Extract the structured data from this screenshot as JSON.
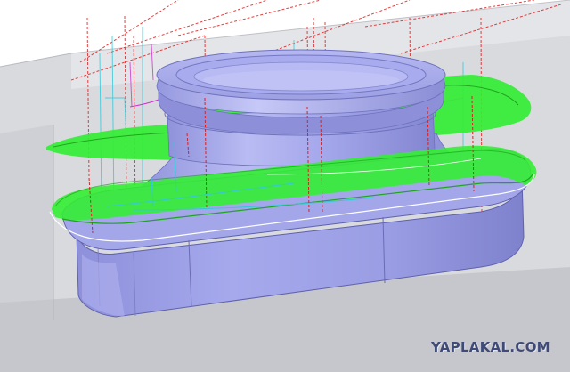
{
  "watermark": "YAPLAKAL.COM",
  "scene": {
    "kind": "CAM toolpath simulation",
    "icons": [
      "machined-part",
      "toolpath-green",
      "rapid-moves-red",
      "feed-moves-cyan"
    ],
    "colors": {
      "background": "#ffffff",
      "fixture": "#d8d9de",
      "part_body": "#9fa2e6",
      "part_shadow": "#7f82cf",
      "part_highlight": "#c9cbf6",
      "toolpath": "#33ee33",
      "rapid": "#dd2020",
      "feed": "#33c8d8",
      "plunge": "#cc33cc"
    }
  }
}
